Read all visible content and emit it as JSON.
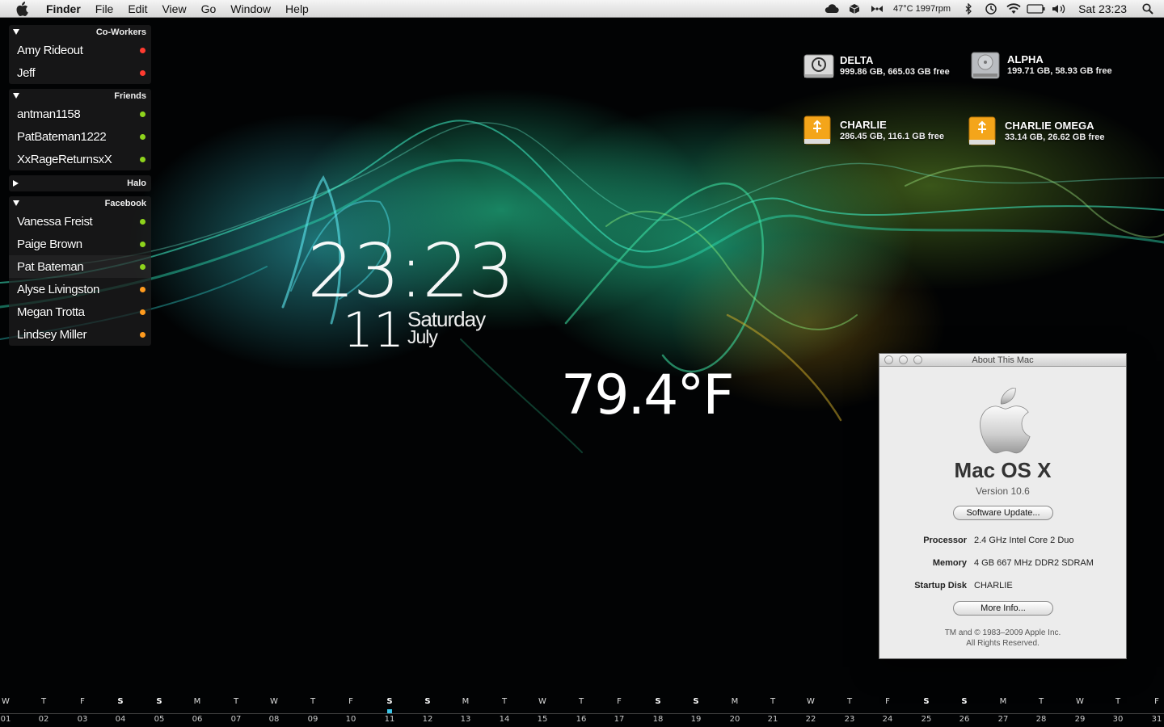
{
  "menubar": {
    "app_name": "Finder",
    "menus": [
      "File",
      "Edit",
      "View",
      "Go",
      "Window",
      "Help"
    ],
    "status_text": "47°C 1997rpm",
    "clock": "Sat 23:23"
  },
  "buddy_list": {
    "groups": [
      {
        "name": "Co-Workers",
        "expanded": true,
        "contacts": [
          {
            "name": "Amy Rideout",
            "status": "red"
          },
          {
            "name": "Jeff",
            "status": "red"
          }
        ]
      },
      {
        "name": "Friends",
        "expanded": true,
        "contacts": [
          {
            "name": "antman1158",
            "status": "green"
          },
          {
            "name": "PatBateman1222",
            "status": "green"
          },
          {
            "name": "XxRageReturnsxX",
            "status": "green"
          }
        ]
      },
      {
        "name": "Halo",
        "expanded": false,
        "contacts": []
      },
      {
        "name": "Facebook",
        "expanded": true,
        "contacts": [
          {
            "name": "Vanessa Freist",
            "status": "green"
          },
          {
            "name": "Paige Brown",
            "status": "green"
          },
          {
            "name": "Pat Bateman",
            "status": "green"
          },
          {
            "name": "Alyse Livingston",
            "status": "orange"
          },
          {
            "name": "Megan Trotta",
            "status": "orange"
          },
          {
            "name": "Lindsey Miller",
            "status": "orange"
          }
        ]
      }
    ]
  },
  "clock_widget": {
    "time": "23:23",
    "day": "11",
    "weekday": "Saturday",
    "month": "July"
  },
  "weather": {
    "temperature": "79.4°F"
  },
  "drives": [
    {
      "name": "DELTA",
      "info": "999.86 GB, 665.03 GB free",
      "icon": "time-machine-drive-icon"
    },
    {
      "name": "ALPHA",
      "info": "199.71 GB, 58.93 GB free",
      "icon": "hard-drive-icon"
    },
    {
      "name": "CHARLIE",
      "info": "286.45 GB, 116.1 GB free",
      "icon": "usb-drive-icon"
    },
    {
      "name": "CHARLIE OMEGA",
      "info": "33.14 GB, 26.62 GB free",
      "icon": "usb-drive-icon"
    }
  ],
  "about_window": {
    "title": "About This Mac",
    "os_name": "Mac OS X",
    "version": "Version 10.6",
    "software_update_label": "Software Update...",
    "specs": [
      {
        "label": "Processor",
        "value": "2.4 GHz Intel Core 2 Duo"
      },
      {
        "label": "Memory",
        "value": "4 GB 667 MHz DDR2 SDRAM"
      },
      {
        "label": "Startup Disk",
        "value": "CHARLIE"
      }
    ],
    "more_info_label": "More Info...",
    "copyright_line1": "TM and © 1983–2009 Apple Inc.",
    "copyright_line2": "All Rights Reserved."
  },
  "calendar_strip": {
    "days": [
      {
        "dow": "W",
        "num": "01"
      },
      {
        "dow": "T",
        "num": "02"
      },
      {
        "dow": "F",
        "num": "03"
      },
      {
        "dow": "S",
        "num": "04"
      },
      {
        "dow": "S",
        "num": "05"
      },
      {
        "dow": "M",
        "num": "06"
      },
      {
        "dow": "T",
        "num": "07"
      },
      {
        "dow": "W",
        "num": "08"
      },
      {
        "dow": "T",
        "num": "09"
      },
      {
        "dow": "F",
        "num": "10"
      },
      {
        "dow": "S",
        "num": "11"
      },
      {
        "dow": "S",
        "num": "12"
      },
      {
        "dow": "M",
        "num": "13"
      },
      {
        "dow": "T",
        "num": "14"
      },
      {
        "dow": "W",
        "num": "15"
      },
      {
        "dow": "T",
        "num": "16"
      },
      {
        "dow": "F",
        "num": "17"
      },
      {
        "dow": "S",
        "num": "18"
      },
      {
        "dow": "S",
        "num": "19"
      },
      {
        "dow": "M",
        "num": "20"
      },
      {
        "dow": "T",
        "num": "21"
      },
      {
        "dow": "W",
        "num": "22"
      },
      {
        "dow": "T",
        "num": "23"
      },
      {
        "dow": "F",
        "num": "24"
      },
      {
        "dow": "S",
        "num": "25"
      },
      {
        "dow": "S",
        "num": "26"
      },
      {
        "dow": "M",
        "num": "27"
      },
      {
        "dow": "T",
        "num": "28"
      },
      {
        "dow": "W",
        "num": "29"
      },
      {
        "dow": "T",
        "num": "30"
      },
      {
        "dow": "F",
        "num": "31"
      }
    ],
    "today": "11",
    "today_color": "#3bc4e6"
  },
  "colors": {
    "status_red": "#ff3b30",
    "status_green": "#8ed31c",
    "status_orange": "#ff9b1e"
  }
}
